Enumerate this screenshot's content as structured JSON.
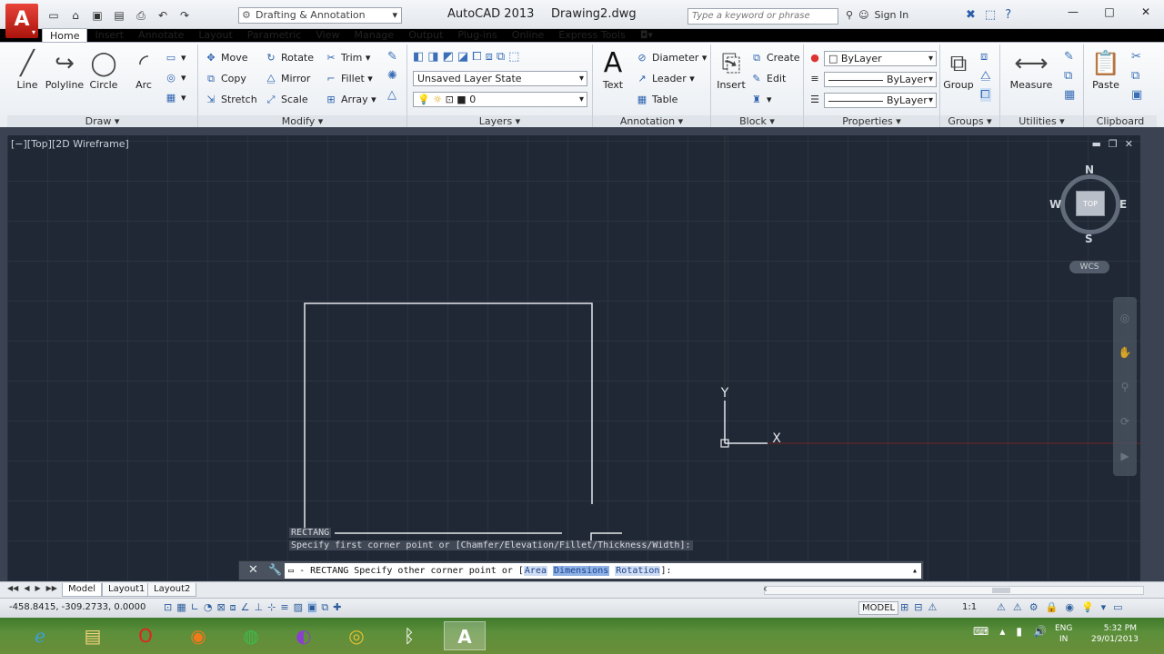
{
  "titlebar": {
    "app_title": "AutoCAD 2013",
    "doc_title": "Drawing2.dwg",
    "workspace": "Drafting & Annotation",
    "search_placeholder": "Type a keyword or phrase",
    "sign_in": "Sign In"
  },
  "tabs": [
    "Home",
    "Insert",
    "Annotate",
    "Layout",
    "Parametric",
    "View",
    "Manage",
    "Output",
    "Plug-ins",
    "Online",
    "Express Tools"
  ],
  "ribbon": {
    "draw": {
      "title": "Draw",
      "line": "Line",
      "polyline": "Polyline",
      "circle": "Circle",
      "arc": "Arc"
    },
    "modify": {
      "title": "Modify",
      "move": "Move",
      "rotate": "Rotate",
      "trim": "Trim",
      "copy": "Copy",
      "mirror": "Mirror",
      "fillet": "Fillet",
      "stretch": "Stretch",
      "scale": "Scale",
      "array": "Array"
    },
    "layers": {
      "title": "Layers",
      "layer_state": "Unsaved Layer State",
      "current_layer": "0"
    },
    "annotation": {
      "title": "Annotation",
      "text": "Text",
      "diameter": "Diameter",
      "leader": "Leader",
      "table": "Table"
    },
    "block": {
      "title": "Block",
      "insert": "Insert",
      "create": "Create",
      "edit": "Edit"
    },
    "properties": {
      "title": "Properties",
      "color": "ByLayer",
      "linetype": "ByLayer",
      "lineweight": "ByLayer"
    },
    "groups": {
      "title": "Groups",
      "group": "Group"
    },
    "utilities": {
      "title": "Utilities",
      "measure": "Measure"
    },
    "clipboard": {
      "title": "Clipboard",
      "paste": "Paste"
    }
  },
  "viewport": {
    "label": "[−][Top][2D Wireframe]",
    "viewcube_face": "TOP",
    "compass": {
      "n": "N",
      "s": "S",
      "e": "E",
      "w": "W"
    },
    "wcs": "WCS",
    "ucs_x": "X",
    "ucs_y": "Y"
  },
  "command": {
    "history_1": "RECTANG",
    "history_2": "Specify first corner point or [Chamfer/Elevation/Fillet/Thickness/Width]:",
    "prefix": "- RECTANG Specify other corner point or [",
    "options": [
      "Area",
      "Dimensions",
      "Rotation"
    ],
    "suffix": "]:"
  },
  "layout_tabs": [
    "Model",
    "Layout1",
    "Layout2"
  ],
  "status": {
    "coords": "-458.8415, -309.2733, 0.0000",
    "model": "MODEL",
    "scale": "1:1"
  },
  "taskbar": {
    "lang_1": "ENG",
    "lang_2": "IN",
    "time": "5:32 PM",
    "date": "29/01/2013"
  },
  "colors": {
    "canvas_bg": "#212835",
    "grid": "#2a3341",
    "geometry": "#e6e9ee",
    "axis_x": "#8a2a2a",
    "autocad_red": "#c8221a"
  }
}
